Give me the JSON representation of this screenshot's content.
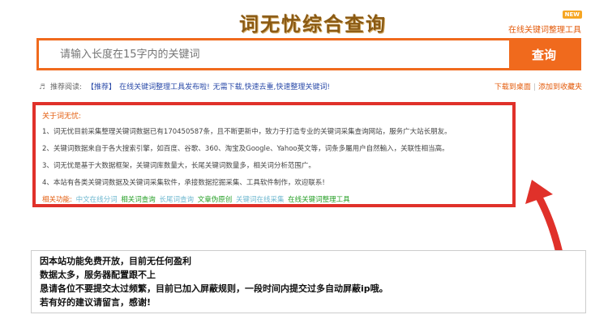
{
  "header": {
    "logo_chars": [
      "词",
      "无",
      "忧",
      "综",
      "合",
      "查",
      "询"
    ],
    "badge": "NEW",
    "top_link": "在线关键词整理工具"
  },
  "search": {
    "placeholder": "请输入长度在15字内的关键词",
    "button_label": "查询"
  },
  "notice": {
    "label": "推荐阅读:",
    "tag": "【推荐】",
    "links": [
      "在线关键词整理工具发布啦!",
      "无需下载,快速去重,快速整理关键词!"
    ],
    "right_links": [
      "下载到桌面",
      "添加到收藏夹"
    ]
  },
  "about": {
    "title": "关于词无忧:",
    "lines": [
      "1、词无忧目前采集整理关键词数据已有170450587条，且不断更新中，致力于打造专业的关键词采集查询网站，服务广大站长朋友。",
      "2、关键词数据来自于各大搜索引擎，如百度、谷歌、360、淘宝及Google、Yahoo英文等，词条多屬用户自然輸入，关联性相当高。",
      "3、词无忧是基于大数据框架，关键词库数量大，长尾关键词数量多，相关词分析范围广。",
      "4、本站有各类关键词数据及关键词采集软件，承接数据挖掘采集、工具软件制作，欢迎联系!"
    ],
    "related_label": "相关功能:",
    "related_links": [
      {
        "text": "中文在线分词",
        "color": "#6fb8d0"
      },
      {
        "text": "相关词查询",
        "color": "#28a028"
      },
      {
        "text": "长尾词查询",
        "color": "#6fb8d0"
      },
      {
        "text": "文章伪原创",
        "color": "#28a028"
      },
      {
        "text": "关键词在线采集",
        "color": "#6fb8d0"
      },
      {
        "text": "在线关键词整理工具",
        "color": "#28a028"
      }
    ]
  },
  "message": {
    "lines": [
      "因本站功能免费开放，目前无任何盈利",
      "数据太多，服务器配置跟不上",
      "恳请各位不要提交太过频繁，目前已加入屏蔽规则，一段时间内提交过多自动屏蔽ip哦。",
      "若有好的建议请留言，感谢!"
    ]
  },
  "colors": {
    "accent": "#f06a1d",
    "highlight_border": "#e0312a",
    "logo": "#8a5a14"
  }
}
